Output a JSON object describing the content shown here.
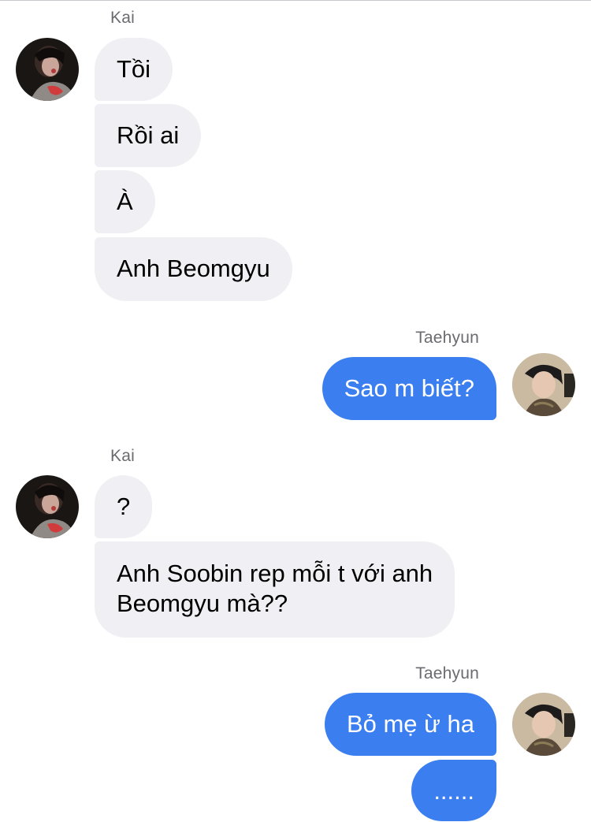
{
  "senders": {
    "kai": "Kai",
    "taehyun": "Taehyun"
  },
  "messages": [
    {
      "sender": "kai",
      "text": "Tồi"
    },
    {
      "sender": "kai",
      "text": "Rồi ai"
    },
    {
      "sender": "kai",
      "text": "À"
    },
    {
      "sender": "kai",
      "text": "Anh Beomgyu"
    },
    {
      "sender": "taehyun",
      "text": "Sao m biết?"
    },
    {
      "sender": "kai",
      "text": "?"
    },
    {
      "sender": "kai",
      "text": "Anh Soobin rep mỗi t với anh\nBeomgyu mà??"
    },
    {
      "sender": "taehyun",
      "text": "Bỏ mẹ ừ ha"
    },
    {
      "sender": "taehyun",
      "text": "......"
    }
  ],
  "colors": {
    "incoming_bubble": "#f0f0f4",
    "outgoing_bubble": "#3a7ef0",
    "sender_name": "#6b6b70"
  },
  "icons": {
    "kai_avatar": "profile-photo-kai",
    "taehyun_avatar": "profile-photo-taehyun"
  }
}
